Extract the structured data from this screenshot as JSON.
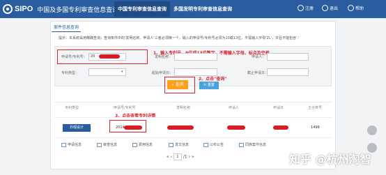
{
  "topbar": {
    "brand": "SIPO",
    "title": "中国及多国专利审查信息查询",
    "tab_active": "中国专利审查信息查询",
    "tab_other": "多国发明专利审查信息查询",
    "right_links": [
      "注册",
      "退出",
      "帮助"
    ]
  },
  "panel": {
    "tab_label": "案件信息查询",
    "hint": "提示：本系统采用精确查询，查询条件中的'发明名称、申请人'三者必须精一个，输入的申请号/专利号必须为10或13位，不需输入字母'ZL'，并且不能包含'.'"
  },
  "form": {
    "application_no_label": "申请号/专利号：",
    "application_no_value": "20",
    "invention_name_label": "发明名称：",
    "applicant_label": "申请人：",
    "patent_type_label": "专利类型：",
    "start_date_label": "起始申请日：",
    "end_date_label": "截止申请日：",
    "search_button": "查询",
    "reset_button": "重置"
  },
  "annotations": {
    "step1": "1、输入专利号，9位或13位数字，不需输入字母、标点及空格",
    "step2": "2、点击\"查询\"",
    "step3": "3、点击查看专利详情"
  },
  "table": {
    "headers": [
      "专利类型",
      "申请号/专利号",
      "发明名称",
      "申请人",
      "申请日",
      "主分类号"
    ],
    "row": {
      "type": "外观设计",
      "app_no": "2014",
      "class_no": "1499"
    },
    "actions": [
      "申请信息",
      "审查信息",
      "费用信息",
      "发文信息",
      "公布公告",
      "同族案件信息"
    ]
  },
  "pager": {
    "current_page": "1",
    "total": "1"
  },
  "watermark": "知乎 @杭州淘智",
  "colors": {
    "header_bg": "#2a5d9f",
    "search_btn": "#ff9e1b",
    "annotation": "#d9232d"
  }
}
